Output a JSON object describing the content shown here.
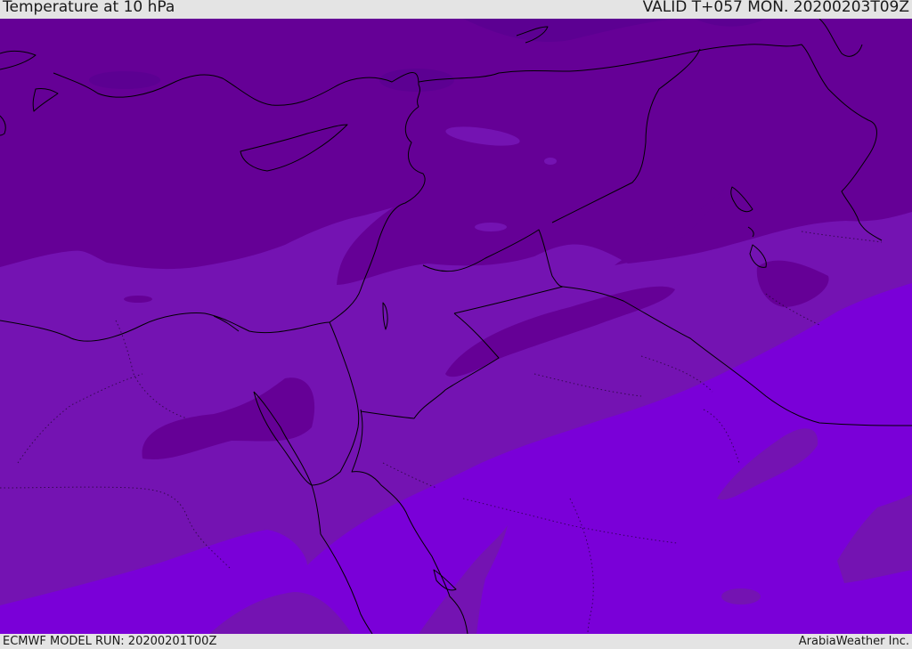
{
  "header": {
    "title": "Temperature at 10 hPa",
    "valid": "VALID T+057 MON. 20200203T09Z"
  },
  "footer": {
    "model_run": "ECMWF MODEL RUN: 20200201T00Z",
    "credit": "ArabiaWeather Inc."
  },
  "colors": {
    "band_coldest": "#5c0092",
    "band_cold": "#650096",
    "band_mid": "#7413b2",
    "band_warm": "#7a00d8",
    "coastline": "#000000"
  }
}
